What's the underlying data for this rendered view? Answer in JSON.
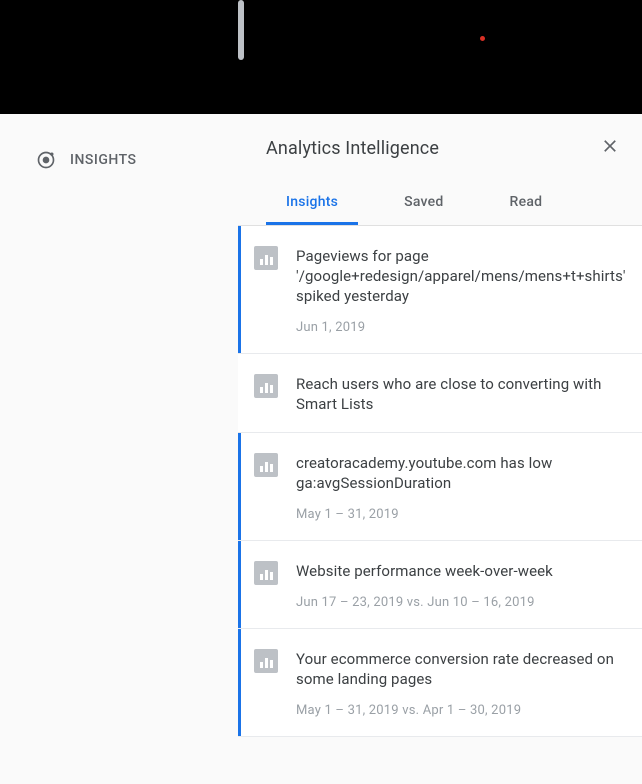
{
  "leftNav": {
    "insights_label": "INSIGHTS"
  },
  "panel": {
    "title": "Analytics Intelligence",
    "tabs": [
      {
        "label": "Insights",
        "active": true
      },
      {
        "label": "Saved",
        "active": false
      },
      {
        "label": "Read",
        "active": false
      }
    ],
    "cards": [
      {
        "highlighted": true,
        "title": "Pageviews for page '/google+redesign/apparel/mens/mens+t+shirts' spiked yesterday",
        "date": "Jun 1, 2019"
      },
      {
        "highlighted": false,
        "title": "Reach users who are close to converting with Smart Lists",
        "date": null
      },
      {
        "highlighted": true,
        "title": "creatoracademy.youtube.com has low ga:avgSessionDuration",
        "date": "May 1 – 31, 2019"
      },
      {
        "highlighted": true,
        "title": "Website performance week-over-week",
        "date": "Jun 17 – 23, 2019 vs. Jun 10 – 16, 2019"
      },
      {
        "highlighted": true,
        "title": "Your ecommerce conversion rate decreased on some landing pages",
        "date": "May 1 – 31, 2019 vs. Apr 1 – 30, 2019"
      }
    ]
  }
}
